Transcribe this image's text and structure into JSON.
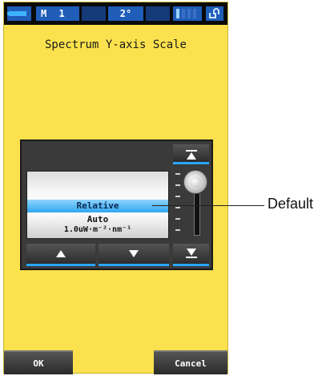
{
  "status_bar": {
    "mode": "M 1",
    "angle": "2°"
  },
  "title": "Spectrum Y-axis Scale",
  "picker": {
    "options": [
      "Relative",
      "Auto",
      "1.0uW·m⁻²·nm⁻¹"
    ],
    "selected_index": 0
  },
  "footer": {
    "ok_label": "OK",
    "cancel_label": "Cancel"
  },
  "callout": {
    "label": "Default"
  },
  "colors": {
    "screen_bg": "#fbe14d",
    "accent": "#29a6ff",
    "status_bar_bg": "#0a0a0a",
    "status_segment": "#1f5db8",
    "selection": "#30a6ef"
  },
  "icons": [
    "battery-icon",
    "memory-icon",
    "lock-icon",
    "scroll-top-icon",
    "scroll-up-icon",
    "scroll-down-icon",
    "scroll-bottom-icon"
  ]
}
